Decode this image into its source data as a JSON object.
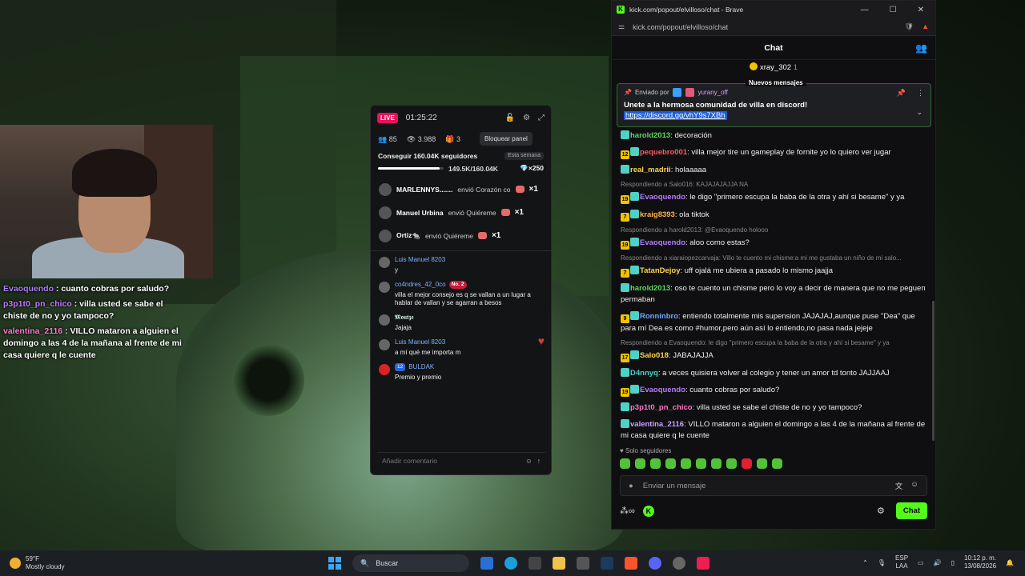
{
  "colors": {
    "kick_green": "#53fc18",
    "live_red": "#e8115c",
    "link_blue": "#1d5dd9"
  },
  "overlay_chat": [
    {
      "user": "Evaoquendo",
      "text": "cuanto cobras por saludo?"
    },
    {
      "user": "p3p1t0_pn_chico",
      "text": "villa usted se sabe el chiste de no y yo tampoco?"
    },
    {
      "user": "valentina_2116",
      "text": "VILLO mataron a alguien el domingo a las 4 de la mañana al frente de mi casa quiere q le cuente"
    }
  ],
  "panel": {
    "live": "LIVE",
    "time": "01:25:22",
    "tooltip": "Bloquear panel",
    "stats": {
      "followers": "85",
      "viewers": "3.988",
      "gifts": "3"
    },
    "goal": {
      "title": "Conseguir 160.04K seguidores",
      "tag": "Esta semana",
      "progress": "149.5K/160.04K",
      "progress_fraction": 0.934,
      "multiplier": "×250"
    },
    "gifts": [
      {
        "user": "MARLENNYS.......",
        "action": "envió Corazón co",
        "count": "×1"
      },
      {
        "user": "Manuel Urbina",
        "action": "envió Quiéreme",
        "count": "×1"
      },
      {
        "user": "Ortiz🐀",
        "action": "envió Quiéreme",
        "count": "×1"
      }
    ],
    "comments": [
      {
        "user": "Luis Manuel 8203",
        "text": "y"
      },
      {
        "user": "co4ndres_42_0co",
        "badge": "No. 2",
        "text": "villa el mejor consejo es q se vallan a un lugar a hablar de vallan y se agarran a besos"
      },
      {
        "user": "𝕸𝖔𝖚𝖙𝖟𝖊",
        "text": "Jajaja"
      },
      {
        "user": "Luis Manuel 8203",
        "text": "a mí qué me importa m"
      },
      {
        "user": "BULDAK",
        "badge": "12",
        "text": "Premio y premio"
      }
    ],
    "input_placeholder": "Añadir comentario"
  },
  "browser": {
    "title": "kick.com/popout/elvilloso/chat - Brave",
    "url": "kick.com/popout/elvilloso/chat",
    "chat_title": "Chat",
    "top_gifter": {
      "user": "xray_302",
      "count": "1"
    },
    "new_messages": "Nuevos mensajes",
    "pinned": {
      "by_label": "Enviado por",
      "by_user": "yurany_off",
      "text": "Unete a la hermosa comunidad de villa en discord!",
      "link": "https://discord.gg/vhY9s7XBh"
    },
    "messages": [
      {
        "reply": "",
        "badges": [],
        "user": "harold2013",
        "ucls": "n-green",
        "text": ": decoración"
      },
      {
        "reply": "",
        "badges": [
          "12"
        ],
        "user": "pequebro001",
        "ucls": "n-red",
        "text": ": villa mejor tire un gameplay de fornite yo lo quiero ver jugar"
      },
      {
        "reply": "",
        "badges": [],
        "user": "real_madrii",
        "ucls": "n-yellow",
        "text": ": holaaaaa"
      },
      {
        "reply": "Respondiendo a Salo016: KAJAJAJAJJA NA",
        "badges": [
          "19"
        ],
        "user": "Evaoquendo",
        "ucls": "n-purple",
        "text": ": le digo \"primero escupa la baba de la otra y ahí si besame\" y ya"
      },
      {
        "reply": "",
        "badges": [
          "7"
        ],
        "user": "kraig8393",
        "ucls": "n-orange",
        "text": ": ola tiktok"
      },
      {
        "reply": "Respondiendo a harold2013: @Evaoquendo holooo",
        "badges": [
          "19"
        ],
        "user": "Evaoquendo",
        "ucls": "n-purple",
        "text": ": aloo como estas?"
      },
      {
        "reply": "Respondiendo a xiaraiopezcarvaja: Villo te cuento mi chisme:a mi me gustaba un niño de mi salo...",
        "badges": [
          "7"
        ],
        "user": "TatanDejoy",
        "ucls": "n-yellow",
        "text": ": uff ojalá me ubiera a pasado lo mismo jaajja"
      },
      {
        "reply": "",
        "badges": [],
        "user": "harold2013",
        "ucls": "n-green",
        "text": ": oso te cuento un chisme pero lo voy a decir de manera que no me peguen permaban"
      },
      {
        "reply": "",
        "badges": [
          "9"
        ],
        "user": "Ronninbro",
        "ucls": "n-blue",
        "text": ": entiendo totalmente mis supension JAJAJAJ,aunque puse \"Dea\" que para mí Dea es como #humor,pero aún así lo entiendo,no pasa nada jejeje"
      },
      {
        "reply": "Respondiendo a Evaoquendo: le digo \"primero escupa la baba de la otra y ahí si besame\" y ya",
        "badges": [
          "17"
        ],
        "user": "Salo018",
        "ucls": "n-yellow",
        "text": ": JABAJAJJA"
      },
      {
        "reply": "",
        "badges": [],
        "user": "D4nnyq",
        "ucls": "n-teal",
        "text": ": a veces quisiera volver al colegio y tener un amor td tonto JAJJAAJ"
      },
      {
        "reply": "",
        "badges": [
          "19"
        ],
        "user": "Evaoquendo",
        "ucls": "n-purple",
        "text": ": cuanto cobras por saludo?"
      },
      {
        "reply": "",
        "badges": [],
        "user": "p3p1t0_pn_chico",
        "ucls": "n-pink",
        "text": ": villa usted se sabe el chiste de no y yo tampoco?"
      },
      {
        "reply": "",
        "badges": [],
        "user": "valentina_2116",
        "ucls": "n-lilac",
        "text": ": VILLO mataron a alguien el domingo a las 4 de la mañana al frente de mi casa quiere q le cuente"
      }
    ],
    "solo_seguidores": "Solo seguidores",
    "send_placeholder": "Enviar un mensaje",
    "chat_button": "Chat"
  },
  "taskbar": {
    "temp": "59°F",
    "weather": "Mostly cloudy",
    "search": "Buscar",
    "lang": "ESP",
    "lang2": "LAA",
    "time": "10:12 p. m.",
    "date": "13/08/2026"
  }
}
